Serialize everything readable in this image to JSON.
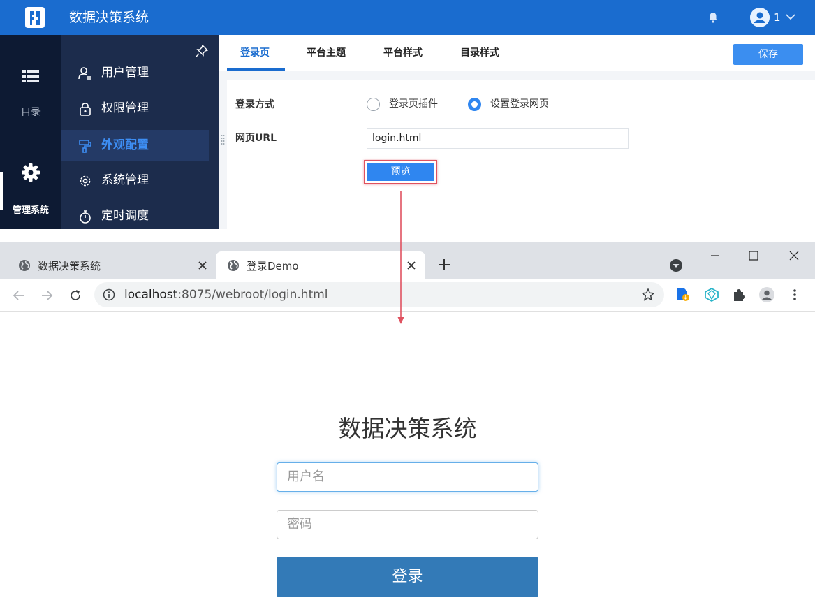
{
  "app": {
    "title": "数据决策系统",
    "user": {
      "name": "1"
    },
    "rail": [
      {
        "label": "目录",
        "icon": "list-icon"
      },
      {
        "label": "管理系统",
        "icon": "gear-icon",
        "active": true
      }
    ],
    "menu": [
      {
        "label": "用户管理",
        "icon": "user-manage-icon"
      },
      {
        "label": "权限管理",
        "icon": "lock-icon"
      },
      {
        "label": "外观配置",
        "icon": "paint-roller-icon",
        "active": true
      },
      {
        "label": "系统管理",
        "icon": "settings-icon"
      },
      {
        "label": "定时调度",
        "icon": "stopwatch-icon"
      }
    ],
    "tabs": [
      {
        "label": "登录页",
        "active": true
      },
      {
        "label": "平台主题"
      },
      {
        "label": "平台样式"
      },
      {
        "label": "目录样式"
      }
    ],
    "save_label": "保存",
    "form": {
      "login_mode_label": "登录方式",
      "options": [
        {
          "label": "登录页插件",
          "selected": false
        },
        {
          "label": "设置登录网页",
          "selected": true
        }
      ],
      "url_label": "网页URL",
      "url_value": "login.html",
      "preview_label": "预览"
    }
  },
  "browser": {
    "tabs": [
      {
        "title": "数据决策系统",
        "active": false
      },
      {
        "title": "登录Demo",
        "active": true
      }
    ],
    "url_host": "localhost",
    "url_rest": ":8075/webroot/login.html"
  },
  "login_page": {
    "title": "数据决策系统",
    "username_placeholder": "用户名",
    "password_placeholder": "密码",
    "submit_label": "登录"
  },
  "colors": {
    "header_blue": "#1a6ccf",
    "rail_bg": "#0d1a33",
    "menu_bg": "#1c2c4c",
    "accent": "#2f86f0",
    "highlight_red": "#e05260",
    "login_button": "#337ab7"
  }
}
